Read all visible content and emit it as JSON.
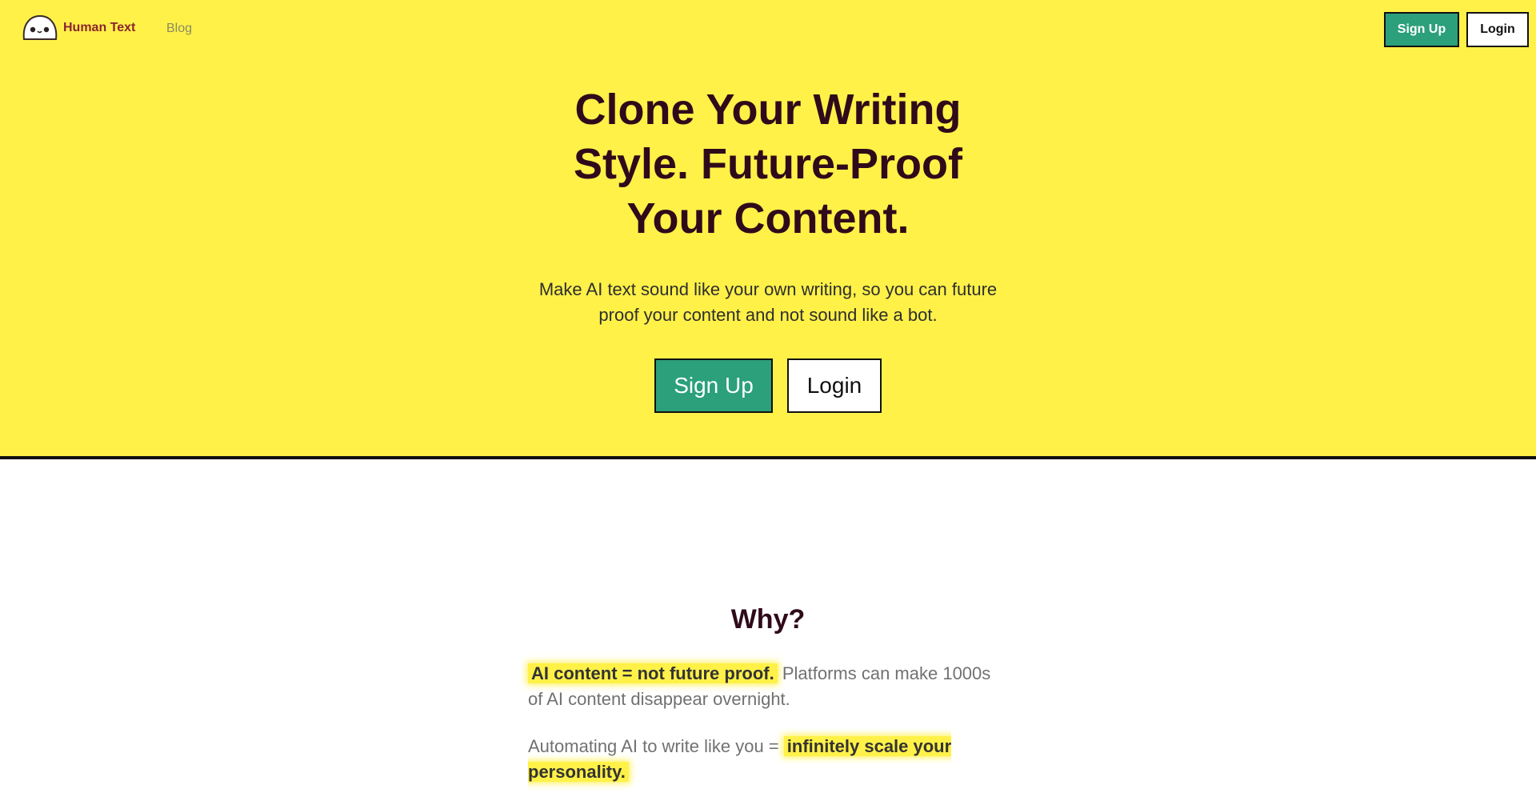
{
  "brand": {
    "name": "Human Text",
    "logo_icon": "ghost-face-icon"
  },
  "nav": {
    "blog_label": "Blog",
    "signup_label": "Sign Up",
    "login_label": "Login"
  },
  "hero": {
    "title": "Clone Your Writing Style. Future-Proof Your Content.",
    "subtitle": "Make AI text sound like your own writing, so you can future proof your content and not sound like a bot.",
    "signup_label": "Sign Up",
    "login_label": "Login"
  },
  "why": {
    "title": "Why?",
    "p1_highlight": "AI content = not future proof.",
    "p1_rest": " Platforms can make 1000s of AI content disappear overnight.",
    "p2_lead": "Automating AI to write like you = ",
    "p2_highlight": "infinitely scale your personality."
  },
  "colors": {
    "hero_bg": "#fff148",
    "accent_green": "#2ba07a",
    "title_color": "#2f0a1a",
    "brand_color": "#8a2430"
  }
}
